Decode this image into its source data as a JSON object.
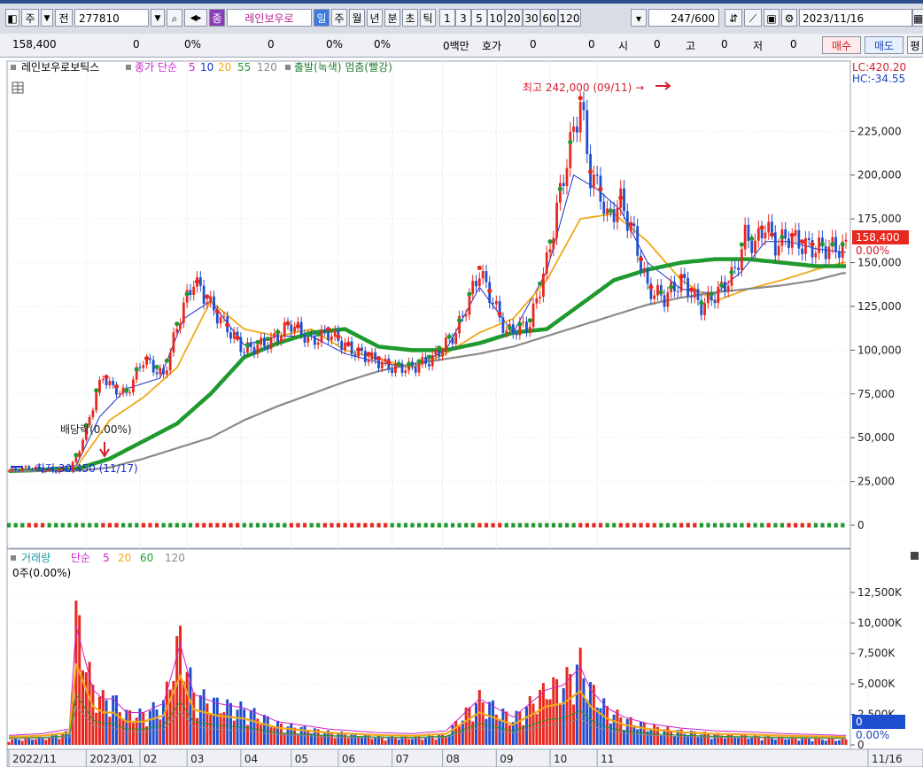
{
  "toolbar": {
    "period_main": "주",
    "jeon_label": "전",
    "code": "277810",
    "badge": "종",
    "stock_name": "레인보우로",
    "periods": [
      "일",
      "주",
      "월",
      "년",
      "분",
      "초",
      "틱"
    ],
    "active_period": "일",
    "intervals": [
      "1",
      "3",
      "5",
      "10",
      "20",
      "30",
      "60",
      "120"
    ],
    "count_shown": "247",
    "count_total": "/600",
    "date": "2023/11/16"
  },
  "quote_bar": {
    "price": "158,400",
    "change": "0",
    "change_pct": "0%",
    "vol": "0",
    "vol_pct": "0%",
    "pct2": "0%",
    "amount": "0백만",
    "hoga_label": "호가",
    "hoga": "0",
    "extra": "0",
    "open_label": "시",
    "open": "0",
    "high_label": "고",
    "high": "0",
    "low_label": "저",
    "low": "0",
    "buy_label": "매수",
    "sell_label": "매도",
    "more_label": "평"
  },
  "legend": {
    "stock_name": "레인보우로보틱스",
    "ma_label": "종가 단순",
    "ma_periods": [
      "5",
      "10",
      "20",
      "55",
      "120"
    ],
    "signal_label": "출발(녹색) 멈춤(빨강)",
    "lc": "LC:420.20",
    "hc": "HC:-34.55"
  },
  "annotations": {
    "high": "최고 242,000 (09/11) →",
    "dividend": "배당락(0.00%)",
    "low": "최저 30,450 (11/17)"
  },
  "current_price_label": "158,400",
  "current_pct_label": "0.00%",
  "volume_legend": {
    "title": "거래량",
    "ma_label": "단순",
    "periods": [
      "5",
      "20",
      "60",
      "120"
    ],
    "value": "0주(0.00%)",
    "current": "0",
    "current_pct": "0.00%"
  },
  "colors": {
    "up": "#e8281e",
    "down": "#1e4fd0",
    "ma5": "#cc22cc",
    "ma10": "#1a2fc8",
    "ma20": "#f0a818",
    "ma55": "#1f9a2e",
    "ma120": "#8a8a8a"
  },
  "chart_data": {
    "type": "line",
    "title": "레인보우로보틱스",
    "x_tick_labels": [
      "2022/11",
      "2023/01",
      "02",
      "03",
      "04",
      "05",
      "06",
      "07",
      "08",
      "09",
      "10",
      "11",
      "11/16"
    ],
    "price_axis_ticks": [
      "225,000",
      "200,000",
      "175,000",
      "150,000",
      "125,000",
      "100,000",
      "75,000",
      "50,000",
      "25,000",
      "0"
    ],
    "price_ylim": [
      0,
      255000
    ],
    "volume_axis_ticks": [
      "12,500K",
      "10,000K",
      "7,500K",
      "5,000K",
      "2,500K",
      "0"
    ],
    "volume_ylim": [
      0,
      13800
    ],
    "series": [
      {
        "name": "종가",
        "kind": "close",
        "x": [
          0,
          6,
          12,
          18,
          20,
          23,
          26,
          28,
          31,
          35,
          40,
          46,
          51,
          55,
          62,
          70,
          78,
          84,
          90,
          95,
          102,
          108,
          114,
          120,
          126,
          133,
          140,
          148,
          155,
          160,
          165,
          170,
          173,
          176,
          178,
          182,
          186,
          190,
          195,
          200,
          206,
          212,
          216,
          219,
          222,
          225,
          228,
          232,
          236,
          240,
          242,
          244,
          246,
          248
        ],
        "values": [
          31000,
          33000,
          31000,
          32000,
          38000,
          55000,
          75000,
          85000,
          78000,
          75000,
          95000,
          85000,
          120000,
          140000,
          120000,
          100000,
          105000,
          115000,
          105000,
          110000,
          100000,
          95000,
          90000,
          90000,
          95000,
          110000,
          145000,
          110000,
          115000,
          150000,
          200000,
          242000,
          200000,
          190000,
          175000,
          185000,
          165000,
          135000,
          130000,
          140000,
          125000,
          135000,
          145000,
          165000,
          160000,
          172000,
          160000,
          165000,
          160000,
          158000,
          158400,
          158400,
          158400,
          158400
        ]
      },
      {
        "name": "10",
        "kind": "ma",
        "x": [
          0,
          20,
          27,
          35,
          45,
          52,
          60,
          70,
          80,
          90,
          100,
          110,
          120,
          130,
          140,
          150,
          160,
          168,
          175,
          182,
          190,
          200,
          210,
          218,
          225,
          232,
          240,
          248
        ],
        "values": [
          31000,
          34000,
          62000,
          78000,
          84000,
          118000,
          128000,
          103000,
          108000,
          108000,
          98000,
          93000,
          90000,
          100000,
          136000,
          110000,
          145000,
          200000,
          192000,
          180000,
          150000,
          135000,
          132000,
          145000,
          162000,
          162000,
          158000,
          156000
        ]
      },
      {
        "name": "20",
        "kind": "ma",
        "x": [
          0,
          20,
          30,
          40,
          50,
          60,
          70,
          80,
          90,
          100,
          110,
          120,
          130,
          140,
          150,
          160,
          170,
          180,
          190,
          200,
          210,
          220,
          230,
          240,
          248
        ],
        "values": [
          31000,
          33000,
          60000,
          73000,
          90000,
          128000,
          112000,
          108000,
          112000,
          100000,
          95000,
          90000,
          98000,
          110000,
          118000,
          140000,
          175000,
          178000,
          162000,
          140000,
          128000,
          135000,
          140000,
          146000,
          150000
        ]
      },
      {
        "name": "55",
        "kind": "ma",
        "x": [
          0,
          20,
          30,
          40,
          50,
          60,
          70,
          80,
          90,
          100,
          110,
          120,
          130,
          140,
          150,
          160,
          170,
          180,
          190,
          200,
          210,
          220,
          230,
          240,
          248
        ],
        "values": [
          31000,
          32000,
          38000,
          48000,
          58000,
          75000,
          96000,
          104000,
          110000,
          112000,
          102000,
          100000,
          100000,
          104000,
          110000,
          112000,
          126000,
          140000,
          146000,
          150000,
          152000,
          152000,
          150000,
          148000,
          148000
        ]
      },
      {
        "name": "120",
        "kind": "ma",
        "x": [
          0,
          20,
          30,
          40,
          50,
          60,
          70,
          80,
          90,
          100,
          110,
          120,
          130,
          140,
          150,
          160,
          170,
          180,
          190,
          200,
          210,
          220,
          230,
          240,
          248
        ],
        "values": [
          31000,
          31000,
          33000,
          38000,
          44000,
          50000,
          60000,
          68000,
          75000,
          82000,
          88000,
          92000,
          95000,
          98000,
          102000,
          108000,
          114000,
          120000,
          126000,
          130000,
          133000,
          135000,
          137000,
          140000,
          144000
        ]
      }
    ],
    "volume": {
      "unit": "K",
      "x": [
        0,
        10,
        18,
        20,
        25,
        28,
        31,
        35,
        40,
        46,
        51,
        55,
        62,
        70,
        80,
        95,
        110,
        120,
        130,
        140,
        150,
        160,
        165,
        170,
        173,
        178,
        183,
        190,
        200,
        210,
        220,
        230,
        240,
        248
      ],
      "values": [
        500,
        700,
        1200,
        12500,
        5500,
        4500,
        4500,
        3000,
        3000,
        4000,
        10500,
        5000,
        4000,
        3500,
        2000,
        1200,
        800,
        700,
        1000,
        4500,
        2500,
        5500,
        6000,
        8000,
        5500,
        3500,
        2500,
        1800,
        1300,
        1000,
        900,
        700,
        600,
        500
      ]
    }
  }
}
